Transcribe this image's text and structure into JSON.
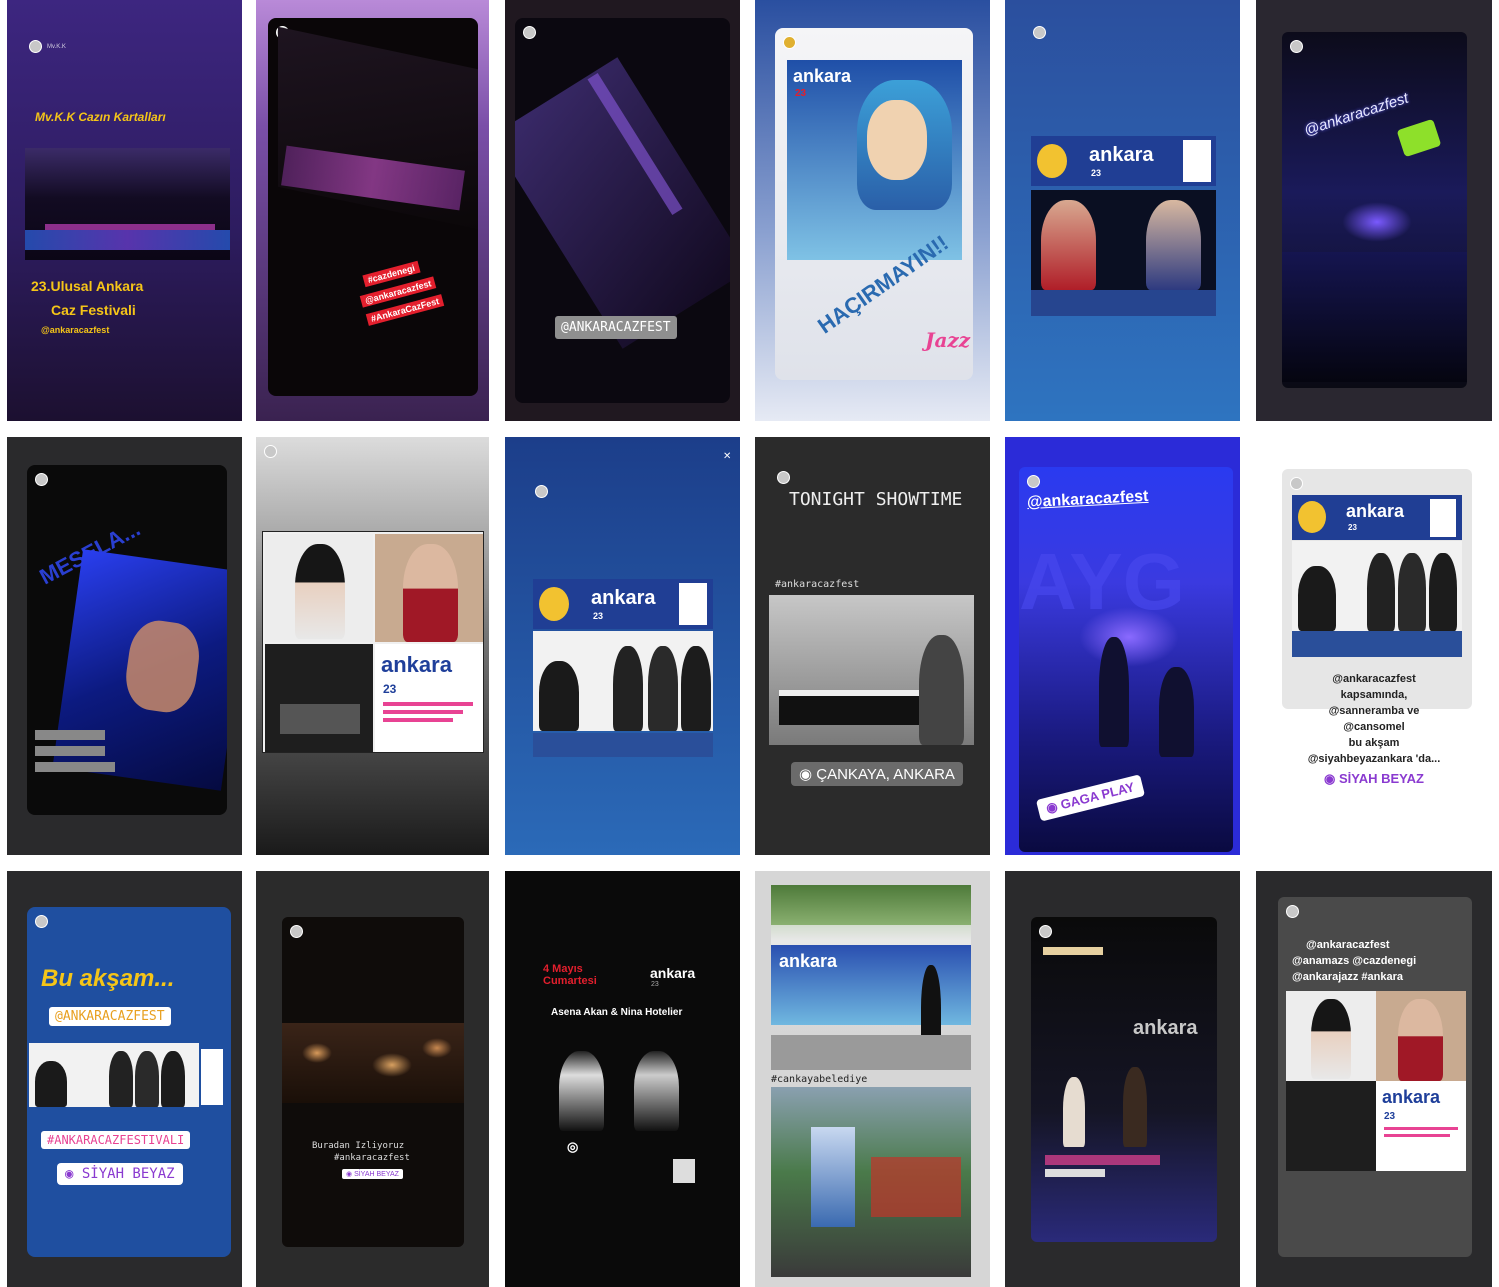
{
  "stories": {
    "s1": {
      "username": "Mv.K.K",
      "title": "Mv.K.K Cazın Kartalları",
      "line1": "23.Ulusal Ankara",
      "line2": "Caz Festivali",
      "handle": "@ankaracazfest"
    },
    "s2": {
      "tags": [
        "#cazdenegi",
        "@ankaracazfest",
        "#AnkaraCazFest"
      ]
    },
    "s3": {
      "sticker": "@ANKARACAZFEST"
    },
    "s4": {
      "brand": "ankara",
      "edition": "23",
      "headline": "HAÇIRMAYIN!!",
      "jazz": "Jazz"
    },
    "s5": {
      "brand": "ankara",
      "edition": "23"
    },
    "s6": {
      "mention": "@ankaracazfest"
    },
    "s7": {
      "overlay": "MESELA..."
    },
    "s8": {
      "brand": "ankara",
      "edition": "23"
    },
    "s9": {
      "brand": "ankara",
      "edition": "23"
    },
    "s10": {
      "headline": "TONIGHT SHOWTIME",
      "hashtag": "#ankaracazfest",
      "location": "ÇANKAYA, ANKARA"
    },
    "s11": {
      "mention": "@ankaracazfest",
      "location": "GAGA PLAY"
    },
    "s12": {
      "brand": "ankara",
      "edition": "23",
      "caption": [
        "@ankaracazfest",
        "kapsamında,",
        "@sanneramba ve",
        "@cansomel",
        "bu akşam",
        "@siyahbeyazankara 'da..."
      ],
      "location": "SİYAH BEYAZ"
    },
    "s13": {
      "headline": "Bu akşam...",
      "mention": "@ANKARACAZFEST",
      "hashtag": "#ANKARACAZFESTIVALI",
      "location": "SİYAH BEYAZ"
    },
    "s14": {
      "caption": "Buradan Izliyoruz",
      "hashtag": "#ankaracazfest",
      "location": "SİYAH BEYAZ"
    },
    "s15": {
      "date": "4 Mayıs Cumartesi",
      "names": "Asena Akan & Nina Hotelier",
      "brand": "ankara",
      "edition": "23"
    },
    "s16": {
      "brand": "ankara",
      "hashtag": "#cankayabelediye"
    },
    "s17": {
      "brand": "ankara"
    },
    "s18": {
      "tags": [
        "@ankaracazfest",
        "@anamazs @cazdenegi",
        "@ankarajazz #ankara"
      ],
      "brand": "ankara",
      "edition": "23"
    }
  },
  "colors": {
    "purple": "#4b2a8a",
    "stageDark": "#140a20",
    "blue": "#2b63b5",
    "posterBlue": "#1f3f9a",
    "red": "#e31f2d",
    "yellow": "#f5c518"
  }
}
